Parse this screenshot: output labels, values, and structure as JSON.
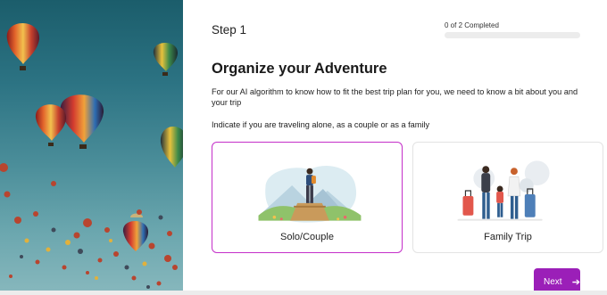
{
  "colors": {
    "accent": "#9b1fb8",
    "selected_border": "#c42fc9"
  },
  "step": {
    "title": "Step 1"
  },
  "progress": {
    "text": "0 of 2 Completed",
    "fraction": 0
  },
  "main": {
    "heading": "Organize your Adventure",
    "description": "For our AI algorithm to know how to fit the best trip plan for you, we need to know a bit about you and your trip",
    "instruction": "Indicate if you are traveling alone, as a couple or as a family"
  },
  "options": [
    {
      "label": "Solo/Couple",
      "selected": true,
      "icon": "hiker-illustration"
    },
    {
      "label": "Family Trip",
      "selected": false,
      "icon": "family-illustration"
    }
  ],
  "footer": {
    "next_label": "Next",
    "next_icon": "arrow-right-icon"
  }
}
